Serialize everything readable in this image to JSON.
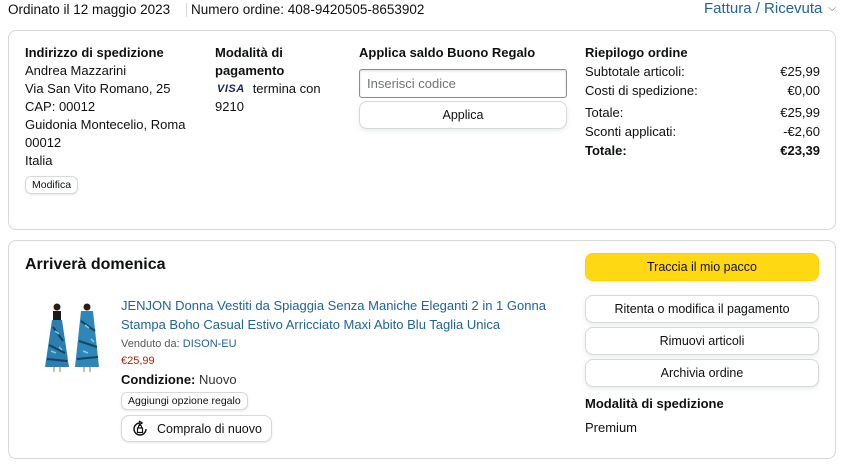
{
  "header": {
    "ordered_on": "Ordinato il 12 maggio 2023",
    "order_number": "Numero ordine: 408-9420505-8653902",
    "invoice_link": "Fattura / Ricevuta"
  },
  "shipping_address": {
    "title": "Indirizzo di spedizione",
    "lines": [
      "Andrea Mazzarini",
      "Via San Vito Romano, 25",
      "CAP: 00012",
      "Guidonia Montecelio, Roma",
      "00012",
      "Italia"
    ],
    "edit_label": "Modifica"
  },
  "payment": {
    "title_line1": "Modalità di",
    "title_line2": "pagamento",
    "card_brand": "VISA",
    "ending_text": "termina con",
    "last_digits": "9210"
  },
  "gift_card": {
    "title": "Applica saldo Buono Regalo",
    "placeholder": "Inserisci codice",
    "apply_label": "Applica"
  },
  "summary": {
    "title": "Riepilogo ordine",
    "rows": [
      {
        "label": "Subtotale articoli:",
        "value": "€25,99"
      },
      {
        "label": "Costi di spedizione:",
        "value": "€0,00"
      },
      {
        "label": "Totale:",
        "value": "€25,99"
      },
      {
        "label": "Sconti applicati:",
        "value": "-€2,60"
      }
    ],
    "grand_total_label": "Totale:",
    "grand_total_value": "€23,39"
  },
  "shipment": {
    "arrival": "Arriverà domenica",
    "product": {
      "title": "JENJON Donna Vestiti da Spiaggia Senza Maniche Eleganti 2 in 1 Gonna Stampa Boho Casual Estivo Arricciato Maxi Abito Blu Taglia Unica",
      "sold_by_label": "Venduto da:",
      "seller": "DISON-EU",
      "price": "€25,99",
      "condition_label": "Condizione:",
      "condition_value": "Nuovo",
      "gift_option_label": "Aggiungi opzione regalo",
      "buy_again_label": "Compralo di nuovo"
    },
    "actions": {
      "track": "Traccia il mio pacco",
      "retry_payment": "Ritenta o modifica il pagamento",
      "remove_items": "Rimuovi articoli",
      "archive": "Archivia ordine"
    },
    "shipping_method_title": "Modalità di spedizione",
    "shipping_method_value": "Premium"
  },
  "colors": {
    "link": "#2162a1",
    "price": "#b12704",
    "primary_button": "#ffd814",
    "border": "#d5d9d9"
  }
}
